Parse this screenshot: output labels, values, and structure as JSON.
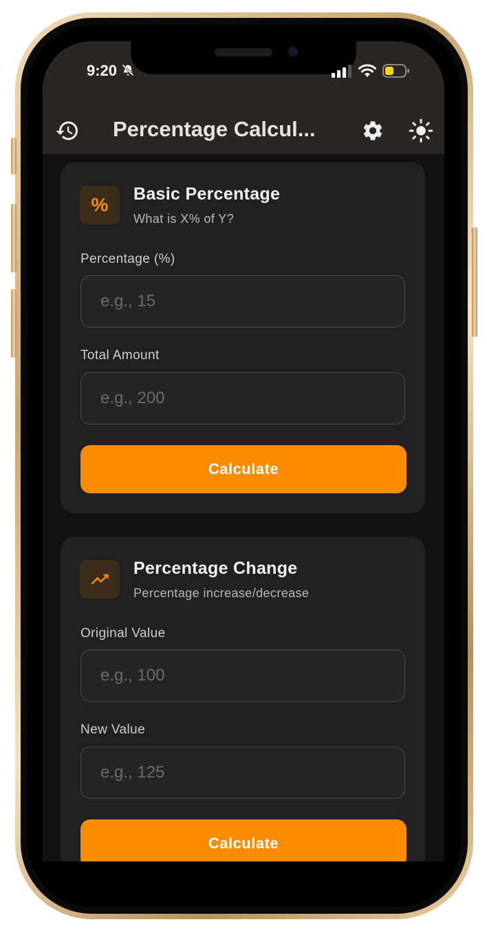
{
  "status_bar": {
    "time": "9:20"
  },
  "app_bar": {
    "title": "Percentage Calcul..."
  },
  "cards": [
    {
      "title": "Basic Percentage",
      "subtitle": "What is X% of Y?",
      "icon_glyph": "%",
      "fields": [
        {
          "label": "Percentage (%)",
          "placeholder": "e.g., 15"
        },
        {
          "label": "Total Amount",
          "placeholder": "e.g., 200"
        }
      ],
      "button_label": "Calculate"
    },
    {
      "title": "Percentage Change",
      "subtitle": "Percentage increase/decrease",
      "icon_name": "trending-up-icon",
      "fields": [
        {
          "label": "Original Value",
          "placeholder": "e.g., 100"
        },
        {
          "label": "New Value",
          "placeholder": "e.g., 125"
        }
      ],
      "button_label": "Calculate"
    }
  ],
  "colors": {
    "accent": "#fb8c00",
    "card_bg": "#212121",
    "app_bar_bg": "#2a2623",
    "background": "#121212"
  }
}
